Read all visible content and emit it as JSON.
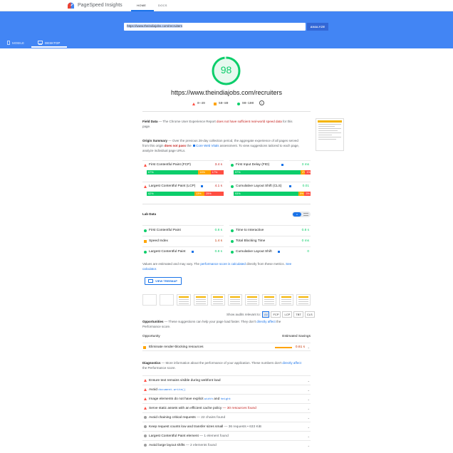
{
  "app": {
    "brand": "PageSpeed Insights",
    "nav": [
      "HOME",
      "DOCS"
    ]
  },
  "search": {
    "url": "https://www.theindiajobs.com/recruiters",
    "button": "ANALYZE"
  },
  "devices": [
    "MOBILE",
    "DESKTOP"
  ],
  "score": {
    "value": "98",
    "fraction": 0.98,
    "color": "#0cce6b"
  },
  "page_url": "https://www.theindiajobs.com/recruiters",
  "legend": {
    "fail": "0–49",
    "average": "50–89",
    "pass": "90–100"
  },
  "colors": {
    "fast": "#0cce6b",
    "average": "#ffa400",
    "slow": "#ff4e42",
    "accent": "#4285f4"
  },
  "field_data": {
    "title": "Field Data",
    "desc_pre": " — The Chrome User Experience Report",
    "desc_link": "does not have sufficient real-world speed data",
    "desc_post": "for this page."
  },
  "origin_summary": {
    "title": "Origin Summary",
    "desc_a": " — Over the previous 28-day collection period, the aggregate experience of all pages served from this origin",
    "desc_fail": "does not pass",
    "desc_b": "the",
    "desc_link": "Core Web Vitals",
    "desc_c": "assessment. To view suggestions tailored to each page, analyze individual page URLs."
  },
  "origin_metrics": [
    {
      "name": "First Contentful Paint (FCP)",
      "value": "3.4 s",
      "status": "average",
      "dist": [
        "67%",
        "16%",
        "17%"
      ],
      "pct": [
        67,
        16,
        17
      ]
    },
    {
      "name": "First Input Delay (FID)",
      "value": "3 ms",
      "status": "pass",
      "dist": [
        "97%",
        "2%",
        "1%"
      ],
      "pct": [
        87,
        6,
        7
      ]
    },
    {
      "name": "Largest Contentful Paint (LCP)",
      "value": "4.1 s",
      "status": "fail",
      "dist": [
        "62%",
        "13%",
        "25%"
      ],
      "pct": [
        62,
        13,
        25
      ]
    },
    {
      "name": "Cumulative Layout Shift (CLS)",
      "value": "0.01",
      "status": "pass",
      "dist": [
        "93%",
        "5%",
        "3%"
      ],
      "pct": [
        84,
        8,
        8
      ]
    }
  ],
  "lab": {
    "title": "Lab Data",
    "metrics": [
      {
        "name": "First Contentful Paint",
        "value": "0.8 s",
        "status": "pass"
      },
      {
        "name": "Time to Interactive",
        "value": "0.8 s",
        "status": "pass"
      },
      {
        "name": "Speed Index",
        "value": "1.4 s",
        "status": "average"
      },
      {
        "name": "Total Blocking Time",
        "value": "0 ms",
        "status": "pass"
      },
      {
        "name": "Largest Contentful Paint",
        "value": "0.8 s",
        "status": "pass"
      },
      {
        "name": "Cumulative Layout Shift",
        "value": "0",
        "status": "pass"
      }
    ],
    "note_a": "Values are estimated and may vary. The",
    "note_link": "performance score is calculated",
    "note_b": "directly from these metrics.",
    "note_link2": "See calculator.",
    "treemap": "VIEW TREEMAP"
  },
  "filter": {
    "label": "Show audits relevant to:",
    "chips": [
      "All",
      "FCP",
      "LCP",
      "TBT",
      "CLS"
    ]
  },
  "opportunities": {
    "title": "Opportunities",
    "desc_a": " — These suggestions can help your page load faster. They don't",
    "desc_link": "directly affect",
    "desc_b": "the Performance score.",
    "col_left": "Opportunity",
    "col_right": "Estimated Savings",
    "items": [
      {
        "name": "Eliminate render-blocking resources",
        "saving": "0.61 s"
      }
    ]
  },
  "diagnostics": {
    "title": "Diagnostics",
    "desc_a": " — More information about the performance of your application. These numbers don't",
    "desc_link": "directly affect",
    "desc_b": "the Performance score.",
    "items": [
      {
        "pre": "Ensure text remains visible during webfont load",
        "code": "",
        "post": "",
        "sub": "",
        "status": "fail"
      },
      {
        "pre": "Avoid",
        "code": "document.write()",
        "post": "",
        "sub": "",
        "status": "fail"
      },
      {
        "pre": "Image elements do not have explicit",
        "code": "width",
        "post": "and",
        "code2": "height",
        "sub": "",
        "status": "fail"
      },
      {
        "pre": "Serve static assets with an efficient cache policy",
        "code": "",
        "post": "",
        "sub": " — 30 resources found",
        "status": "fail"
      },
      {
        "pre": "Avoid chaining critical requests",
        "code": "",
        "post": "",
        "sub": " — 22 chains found",
        "status": "info"
      },
      {
        "pre": "Keep request counts low and transfer sizes small",
        "code": "",
        "post": "",
        "sub": " — 36 requests • 633 KiB",
        "status": "info"
      },
      {
        "pre": "Largest Contentful Paint element",
        "code": "",
        "post": "",
        "sub": " — 1 element found",
        "status": "info"
      },
      {
        "pre": "Avoid large layout shifts",
        "code": "",
        "post": "",
        "sub": " — 2 elements found",
        "status": "info"
      }
    ]
  }
}
